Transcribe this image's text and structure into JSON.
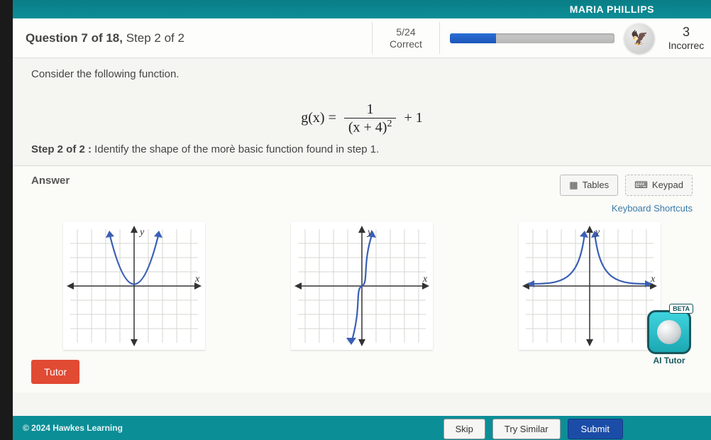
{
  "header": {
    "student_name": "MARIA PHILLIPS",
    "question_label": "Question 7 of 18,",
    "step_label": "Step 2 of 2",
    "correct_count": "5/24",
    "correct_label": "Correct",
    "incorrect_count": "3",
    "incorrect_label": "Incorrec",
    "progress_percent": 28
  },
  "problem": {
    "consider_text": "Consider the following function.",
    "formula_lhs": "g(x) =",
    "formula_num": "1",
    "formula_den_a": "(x + 4)",
    "formula_den_exp": "2",
    "formula_tail": "+ 1",
    "step_bold": "Step 2 of 2 :",
    "step_text": " Identify the shape of the morè basic function found in step 1."
  },
  "answer": {
    "label": "Answer",
    "tables_btn": "Tables",
    "keypad_btn": "Keypad",
    "shortcuts": "Keyboard Shortcuts",
    "y_label": "y",
    "x_label": "x"
  },
  "actions": {
    "tutor": "Tutor",
    "skip": "Skip",
    "try_similar": "Try Similar",
    "submit": "Submit"
  },
  "ai_tutor": {
    "beta": "BETA",
    "label": "AI Tutor"
  },
  "footer": {
    "copyright": "© 2024 Hawkes Learning"
  }
}
